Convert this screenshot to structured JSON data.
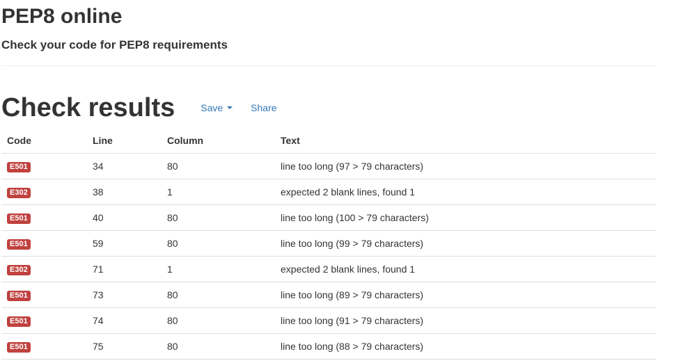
{
  "header": {
    "title": "PEP8 online",
    "subtitle": "Check your code for PEP8 requirements"
  },
  "results": {
    "title": "Check results",
    "save_label": "Save",
    "share_label": "Share"
  },
  "table": {
    "columns": [
      "Code",
      "Line",
      "Column",
      "Text"
    ],
    "rows": [
      {
        "code": "E501",
        "line": "34",
        "column": "80",
        "text": "line too long (97 > 79 characters)"
      },
      {
        "code": "E302",
        "line": "38",
        "column": "1",
        "text": "expected 2 blank lines, found 1"
      },
      {
        "code": "E501",
        "line": "40",
        "column": "80",
        "text": "line too long (100 > 79 characters)"
      },
      {
        "code": "E501",
        "line": "59",
        "column": "80",
        "text": "line too long (99 > 79 characters)"
      },
      {
        "code": "E302",
        "line": "71",
        "column": "1",
        "text": "expected 2 blank lines, found 1"
      },
      {
        "code": "E501",
        "line": "73",
        "column": "80",
        "text": "line too long (89 > 79 characters)"
      },
      {
        "code": "E501",
        "line": "74",
        "column": "80",
        "text": "line too long (91 > 79 characters)"
      },
      {
        "code": "E501",
        "line": "75",
        "column": "80",
        "text": "line too long (88 > 79 characters)"
      }
    ]
  },
  "colors": {
    "link": "#337ab7",
    "badge_error": "#c0413f",
    "text": "#333333"
  }
}
